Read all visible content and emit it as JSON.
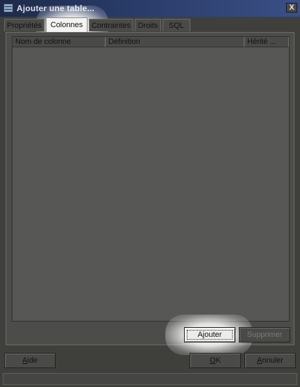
{
  "window": {
    "title": "Ajouter une table...",
    "close_label": "X"
  },
  "tabs": [
    {
      "label": "Propriétés",
      "active": false
    },
    {
      "label": "Colonnes",
      "active": true
    },
    {
      "label": "Contraintes",
      "active": false
    },
    {
      "label": "Droits",
      "active": false
    },
    {
      "label": "SQL",
      "active": false
    }
  ],
  "columns_grid": {
    "headers": [
      "Nom de colonne",
      "Définition",
      "Hérité ..."
    ],
    "rows": []
  },
  "panel_buttons": {
    "add": {
      "label": "Ajouter",
      "enabled": true
    },
    "remove": {
      "label": "Supprimer",
      "enabled": false
    }
  },
  "footer_buttons": {
    "help": {
      "label": "Aide"
    },
    "ok": {
      "label": "OK"
    },
    "cancel": {
      "label": "Annuler"
    }
  },
  "status": {
    "text": ""
  }
}
